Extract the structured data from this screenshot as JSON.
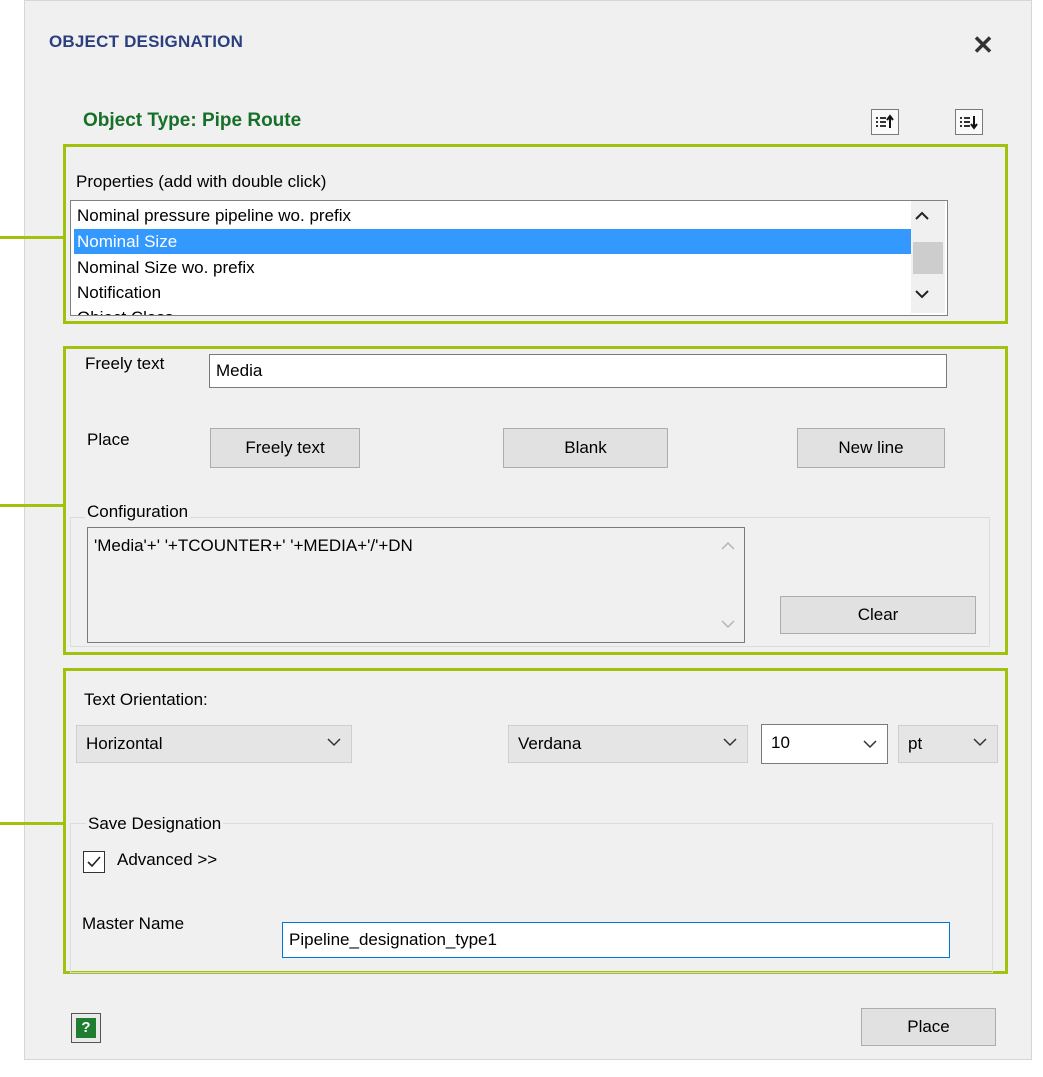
{
  "dialog": {
    "title": "OBJECT DESIGNATION",
    "close_icon": "✕",
    "object_type": "Object Type: Pipe Route"
  },
  "toolbar": {
    "sort_up_icon": "sort-ascending-icon",
    "sort_down_icon": "sort-descending-icon"
  },
  "properties": {
    "label": "Properties (add with double click)",
    "items": [
      "Nominal pressure pipeline wo. prefix",
      "Nominal Size",
      "Nominal Size wo. prefix",
      "Notification",
      "Object Class"
    ],
    "selected_index": 1
  },
  "freely": {
    "label": "Freely text",
    "value": "Media"
  },
  "place": {
    "label": "Place",
    "freely_text_button": "Freely text",
    "blank_button": "Blank",
    "new_line_button": "New line"
  },
  "configuration": {
    "label": "Configuration",
    "text": "'Media'+' '+TCOUNTER+' '+MEDIA+'/'+DN",
    "clear_button": "Clear"
  },
  "text_orientation": {
    "label": "Text Orientation:",
    "orientation": "Horizontal",
    "font": "Verdana",
    "size": "10",
    "unit": "pt"
  },
  "save_designation": {
    "label": "Save Designation",
    "advanced_label": "Advanced >>",
    "advanced_checked": true,
    "master_name_label": "Master Name",
    "master_name_value": "Pipeline_designation_type1"
  },
  "footer": {
    "help_icon": "?",
    "place_button": "Place"
  },
  "colors": {
    "highlight": "#a0c20f",
    "title": "#2b3f7e",
    "object_type": "#17702a",
    "selection": "#3399ff"
  }
}
